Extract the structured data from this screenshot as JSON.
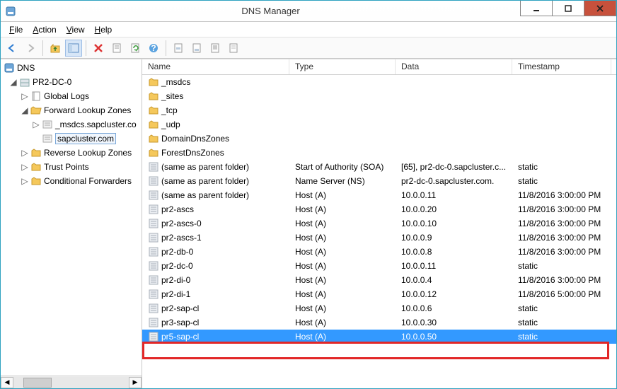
{
  "window": {
    "title": "DNS Manager"
  },
  "menu": {
    "file": "File",
    "action": "Action",
    "view": "View",
    "help": "Help"
  },
  "tree": {
    "root": "DNS",
    "server": "PR2-DC-0",
    "nodes": {
      "global_logs": "Global Logs",
      "flz": "Forward Lookup Zones",
      "msdcs_zone": "_msdcs.sapcluster.co",
      "sapcluster_zone": "sapcluster.com",
      "rlz": "Reverse Lookup Zones",
      "trust_points": "Trust Points",
      "cond_fwd": "Conditional Forwarders"
    }
  },
  "columns": {
    "name": "Name",
    "type": "Type",
    "data": "Data",
    "timestamp": "Timestamp"
  },
  "folders": [
    {
      "name": "_msdcs"
    },
    {
      "name": "_sites"
    },
    {
      "name": "_tcp"
    },
    {
      "name": "_udp"
    },
    {
      "name": "DomainDnsZones"
    },
    {
      "name": "ForestDnsZones"
    }
  ],
  "records": [
    {
      "name": "(same as parent folder)",
      "type": "Start of Authority (SOA)",
      "data": "[65], pr2-dc-0.sapcluster.c...",
      "ts": "static"
    },
    {
      "name": "(same as parent folder)",
      "type": "Name Server (NS)",
      "data": "pr2-dc-0.sapcluster.com.",
      "ts": "static"
    },
    {
      "name": "(same as parent folder)",
      "type": "Host (A)",
      "data": "10.0.0.11",
      "ts": "11/8/2016 3:00:00 PM"
    },
    {
      "name": "pr2-ascs",
      "type": "Host (A)",
      "data": "10.0.0.20",
      "ts": "11/8/2016 3:00:00 PM"
    },
    {
      "name": "pr2-ascs-0",
      "type": "Host (A)",
      "data": "10.0.0.10",
      "ts": "11/8/2016 3:00:00 PM"
    },
    {
      "name": "pr2-ascs-1",
      "type": "Host (A)",
      "data": "10.0.0.9",
      "ts": "11/8/2016 3:00:00 PM"
    },
    {
      "name": "pr2-db-0",
      "type": "Host (A)",
      "data": "10.0.0.8",
      "ts": "11/8/2016 3:00:00 PM"
    },
    {
      "name": "pr2-dc-0",
      "type": "Host (A)",
      "data": "10.0.0.11",
      "ts": "static"
    },
    {
      "name": "pr2-di-0",
      "type": "Host (A)",
      "data": "10.0.0.4",
      "ts": "11/8/2016 3:00:00 PM"
    },
    {
      "name": "pr2-di-1",
      "type": "Host (A)",
      "data": "10.0.0.12",
      "ts": "11/8/2016 5:00:00 PM"
    },
    {
      "name": "pr2-sap-cl",
      "type": "Host (A)",
      "data": "10.0.0.6",
      "ts": "static"
    },
    {
      "name": "pr3-sap-cl",
      "type": "Host (A)",
      "data": "10.0.0.30",
      "ts": "static"
    },
    {
      "name": "pr5-sap-cl",
      "type": "Host (A)",
      "data": "10.0.0.50",
      "ts": "static",
      "selected": true
    }
  ],
  "icons": {
    "folder_color": "#f5c85b",
    "folder_stroke": "#c8992c",
    "record_color": "#d8dde3"
  }
}
